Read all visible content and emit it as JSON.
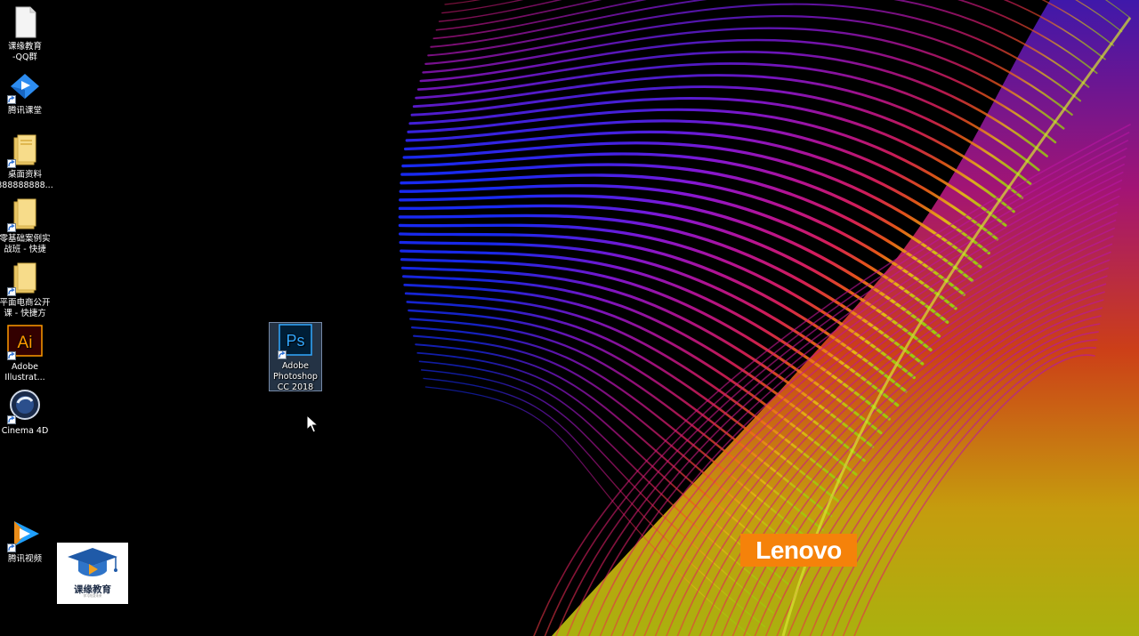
{
  "desktop": {
    "icons": [
      {
        "label": "课缘教育\n-QQ群",
        "icon": "document-file-icon"
      },
      {
        "label": "腾讯课堂",
        "icon": "tencent-classroom-icon"
      },
      {
        "label": "桌面资料\n888888888...",
        "icon": "folder-icon"
      },
      {
        "label": "零基础案例实\n战班 - 快捷",
        "icon": "folder-icon"
      },
      {
        "label": "平面电商公开\n课 - 快捷方",
        "icon": "folder-icon"
      },
      {
        "label": "Adobe\nIllustrat...",
        "icon": "adobe-illustrator-icon",
        "glyph_text": "Ai"
      },
      {
        "label": "Cinema 4D",
        "icon": "cinema4d-icon"
      },
      {
        "label": "腾讯视频",
        "icon": "tencent-video-icon"
      },
      {
        "label": "Adobe\nPhotoshop\nCC 2018",
        "icon": "adobe-photoshop-icon",
        "glyph_text": "Ps",
        "selected": true
      }
    ]
  },
  "overlay": {
    "brand_logo": "Lenovo",
    "org_logo_text": "课缘教育",
    "org_logo_subtext": "学习改变未来"
  },
  "colors": {
    "photoshop_blue": "#31a8ff",
    "photoshop_bg": "#001e36",
    "illustrator_orange": "#ff9a00",
    "illustrator_bg": "#330000",
    "lenovo_orange": "#f5820a"
  }
}
